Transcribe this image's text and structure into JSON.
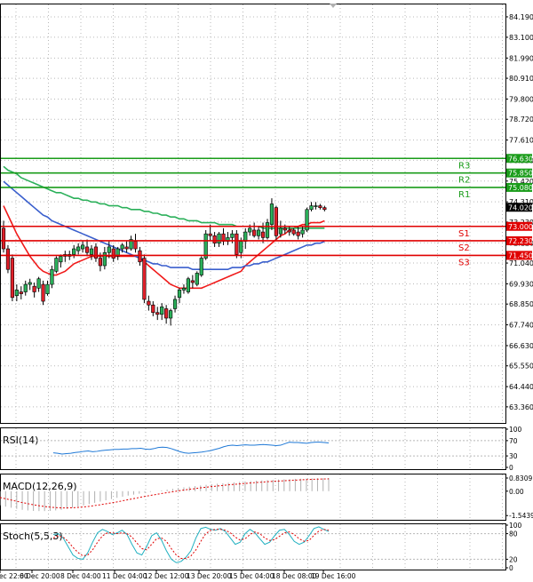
{
  "chart_data": [
    {
      "type": "candlestick",
      "panel": "price",
      "ylim": [
        62.5,
        84.9
      ],
      "y_ticks": [
        "84.190",
        "83.100",
        "81.990",
        "80.910",
        "79.800",
        "78.720",
        "77.610",
        "76.530",
        "75.420",
        "74.310",
        "73.230",
        "72.120",
        "71.040",
        "69.930",
        "68.850",
        "67.740",
        "66.630",
        "65.550",
        "64.440",
        "63.360"
      ],
      "x_tick_labels": [
        "5 Dec 22:00",
        "6 Dec 20:00",
        "8 Dec 04:00",
        "11 Dec 04:00",
        "12 Dec 12:00",
        "13 Dec 20:00",
        "15 Dec 04:00",
        "18 Dec 08:00",
        "19 Dec 16:00"
      ],
      "grid": true,
      "candles": [
        {
          "o": 72.9,
          "h": 73.3,
          "l": 71.6,
          "c": 71.8
        },
        {
          "o": 71.8,
          "h": 72.0,
          "l": 70.5,
          "c": 70.7
        },
        {
          "o": 71.3,
          "h": 71.5,
          "l": 69.0,
          "c": 69.2
        },
        {
          "o": 69.3,
          "h": 69.9,
          "l": 69.0,
          "c": 69.6
        },
        {
          "o": 69.5,
          "h": 69.8,
          "l": 69.1,
          "c": 69.4
        },
        {
          "o": 69.5,
          "h": 70.1,
          "l": 69.3,
          "c": 69.9
        },
        {
          "o": 69.9,
          "h": 70.2,
          "l": 69.6,
          "c": 70.0
        },
        {
          "o": 69.8,
          "h": 70.0,
          "l": 69.2,
          "c": 69.5
        },
        {
          "o": 69.7,
          "h": 70.3,
          "l": 69.5,
          "c": 70.2
        },
        {
          "o": 69.9,
          "h": 70.1,
          "l": 68.8,
          "c": 69.0
        },
        {
          "o": 69.4,
          "h": 70.1,
          "l": 69.3,
          "c": 69.9
        },
        {
          "o": 69.9,
          "h": 70.9,
          "l": 69.7,
          "c": 70.7
        },
        {
          "o": 70.6,
          "h": 71.4,
          "l": 70.5,
          "c": 71.3
        },
        {
          "o": 71.1,
          "h": 71.5,
          "l": 70.8,
          "c": 71.4
        },
        {
          "o": 71.4,
          "h": 71.7,
          "l": 71.1,
          "c": 71.5
        },
        {
          "o": 71.4,
          "h": 71.7,
          "l": 71.2,
          "c": 71.5
        },
        {
          "o": 71.5,
          "h": 72.0,
          "l": 71.3,
          "c": 71.8
        },
        {
          "o": 71.7,
          "h": 72.1,
          "l": 71.5,
          "c": 71.9
        },
        {
          "o": 71.8,
          "h": 72.2,
          "l": 71.6,
          "c": 72.0
        },
        {
          "o": 71.9,
          "h": 72.3,
          "l": 71.4,
          "c": 71.6
        },
        {
          "o": 71.5,
          "h": 72.0,
          "l": 71.2,
          "c": 71.8
        },
        {
          "o": 71.9,
          "h": 72.1,
          "l": 71.1,
          "c": 71.3
        },
        {
          "o": 71.3,
          "h": 71.6,
          "l": 70.6,
          "c": 70.9
        },
        {
          "o": 70.9,
          "h": 71.9,
          "l": 70.7,
          "c": 71.6
        },
        {
          "o": 71.6,
          "h": 72.2,
          "l": 71.3,
          "c": 71.9
        },
        {
          "o": 71.8,
          "h": 72.0,
          "l": 71.1,
          "c": 71.3
        },
        {
          "o": 71.4,
          "h": 71.9,
          "l": 71.2,
          "c": 71.8
        },
        {
          "o": 71.8,
          "h": 72.1,
          "l": 71.6,
          "c": 72.0
        },
        {
          "o": 71.9,
          "h": 72.2,
          "l": 71.6,
          "c": 71.8
        },
        {
          "o": 71.8,
          "h": 72.5,
          "l": 71.7,
          "c": 72.3
        },
        {
          "o": 72.2,
          "h": 72.6,
          "l": 71.6,
          "c": 71.8
        },
        {
          "o": 71.7,
          "h": 71.9,
          "l": 70.9,
          "c": 71.1
        },
        {
          "o": 71.3,
          "h": 71.5,
          "l": 68.9,
          "c": 69.1
        },
        {
          "o": 69.0,
          "h": 69.3,
          "l": 68.5,
          "c": 68.8
        },
        {
          "o": 68.8,
          "h": 69.0,
          "l": 68.2,
          "c": 68.4
        },
        {
          "o": 68.4,
          "h": 68.7,
          "l": 68.0,
          "c": 68.3
        },
        {
          "o": 68.3,
          "h": 68.9,
          "l": 68.0,
          "c": 68.7
        },
        {
          "o": 68.6,
          "h": 68.8,
          "l": 67.8,
          "c": 68.1
        },
        {
          "o": 68.1,
          "h": 68.6,
          "l": 67.7,
          "c": 68.5
        },
        {
          "o": 68.6,
          "h": 69.3,
          "l": 68.4,
          "c": 69.1
        },
        {
          "o": 69.2,
          "h": 69.7,
          "l": 68.9,
          "c": 69.6
        },
        {
          "o": 69.6,
          "h": 69.9,
          "l": 69.4,
          "c": 69.7
        },
        {
          "o": 69.5,
          "h": 70.3,
          "l": 69.4,
          "c": 70.2
        },
        {
          "o": 70.1,
          "h": 70.4,
          "l": 69.7,
          "c": 70.0
        },
        {
          "o": 69.9,
          "h": 70.6,
          "l": 69.8,
          "c": 70.5
        },
        {
          "o": 70.4,
          "h": 71.4,
          "l": 70.3,
          "c": 71.3
        },
        {
          "o": 71.3,
          "h": 72.8,
          "l": 71.2,
          "c": 72.6
        },
        {
          "o": 72.6,
          "h": 73.1,
          "l": 72.2,
          "c": 72.5
        },
        {
          "o": 72.5,
          "h": 72.7,
          "l": 71.9,
          "c": 72.1
        },
        {
          "o": 72.1,
          "h": 72.7,
          "l": 71.9,
          "c": 72.6
        },
        {
          "o": 72.6,
          "h": 72.9,
          "l": 72.0,
          "c": 72.2
        },
        {
          "o": 72.2,
          "h": 72.7,
          "l": 72.0,
          "c": 72.4
        },
        {
          "o": 72.4,
          "h": 72.8,
          "l": 72.1,
          "c": 72.6
        },
        {
          "o": 72.6,
          "h": 72.8,
          "l": 71.3,
          "c": 71.5
        },
        {
          "o": 71.6,
          "h": 72.4,
          "l": 71.3,
          "c": 72.2
        },
        {
          "o": 72.2,
          "h": 72.9,
          "l": 71.8,
          "c": 72.7
        },
        {
          "o": 72.7,
          "h": 73.1,
          "l": 72.5,
          "c": 72.9
        },
        {
          "o": 72.8,
          "h": 73.2,
          "l": 72.4,
          "c": 72.5
        },
        {
          "o": 72.5,
          "h": 73.0,
          "l": 72.3,
          "c": 72.8
        },
        {
          "o": 72.7,
          "h": 73.2,
          "l": 72.1,
          "c": 72.4
        },
        {
          "o": 72.4,
          "h": 73.4,
          "l": 72.3,
          "c": 73.2
        },
        {
          "o": 73.1,
          "h": 74.5,
          "l": 72.8,
          "c": 74.2
        },
        {
          "o": 74.0,
          "h": 74.1,
          "l": 72.3,
          "c": 72.5
        },
        {
          "o": 72.6,
          "h": 73.3,
          "l": 72.4,
          "c": 72.9
        },
        {
          "o": 72.9,
          "h": 73.1,
          "l": 72.6,
          "c": 72.8
        },
        {
          "o": 72.8,
          "h": 73.0,
          "l": 72.5,
          "c": 72.7
        },
        {
          "o": 72.8,
          "h": 72.9,
          "l": 72.5,
          "c": 72.6
        },
        {
          "o": 72.7,
          "h": 73.0,
          "l": 72.3,
          "c": 72.5
        },
        {
          "o": 72.6,
          "h": 73.0,
          "l": 72.4,
          "c": 72.8
        },
        {
          "o": 72.8,
          "h": 74.0,
          "l": 72.7,
          "c": 73.9
        },
        {
          "o": 73.9,
          "h": 74.3,
          "l": 73.8,
          "c": 74.1
        },
        {
          "o": 74.1,
          "h": 74.3,
          "l": 73.9,
          "c": 74.1
        },
        {
          "o": 74.1,
          "h": 74.2,
          "l": 73.9,
          "c": 74.0
        },
        {
          "o": 74.0,
          "h": 74.1,
          "l": 73.8,
          "c": 73.9
        }
      ],
      "moving_averages": [
        {
          "color": "#f01a1a",
          "values": [
            74.1,
            73.6,
            73.1,
            72.6,
            72.2,
            71.8,
            71.4,
            71.1,
            70.8,
            70.6,
            70.5,
            70.4,
            70.4,
            70.5,
            70.6,
            70.8,
            71.0,
            71.1,
            71.2,
            71.3,
            71.4,
            71.4,
            71.4,
            71.4,
            71.4,
            71.4,
            71.4,
            71.4,
            71.4,
            71.4,
            71.4,
            71.3,
            71.1,
            70.9,
            70.7,
            70.5,
            70.3,
            70.1,
            69.9,
            69.8,
            69.7,
            69.7,
            69.7,
            69.7,
            69.7,
            69.7,
            69.8,
            69.9,
            70.0,
            70.1,
            70.2,
            70.3,
            70.4,
            70.5,
            70.6,
            70.9,
            71.1,
            71.3,
            71.5,
            71.7,
            71.9,
            72.1,
            72.3,
            72.5,
            72.6,
            72.8,
            72.9,
            73.0,
            73.1,
            73.1,
            73.2,
            73.2,
            73.2,
            73.3
          ]
        },
        {
          "color": "#3a5fcd",
          "values": [
            75.4,
            75.2,
            75.0,
            74.8,
            74.6,
            74.4,
            74.2,
            74.0,
            73.8,
            73.6,
            73.5,
            73.3,
            73.2,
            73.1,
            73.0,
            72.9,
            72.8,
            72.7,
            72.6,
            72.5,
            72.4,
            72.3,
            72.2,
            72.1,
            72.0,
            71.9,
            71.8,
            71.7,
            71.6,
            71.5,
            71.4,
            71.3,
            71.2,
            71.1,
            71.0,
            71.0,
            70.9,
            70.9,
            70.8,
            70.8,
            70.8,
            70.8,
            70.8,
            70.7,
            70.7,
            70.7,
            70.7,
            70.7,
            70.7,
            70.7,
            70.7,
            70.7,
            70.8,
            70.8,
            70.8,
            70.9,
            70.9,
            71.0,
            71.0,
            71.1,
            71.1,
            71.2,
            71.3,
            71.4,
            71.5,
            71.6,
            71.7,
            71.8,
            71.9,
            72.0,
            72.0,
            72.1,
            72.1,
            72.2
          ]
        },
        {
          "color": "#2bb05a",
          "values": [
            76.2,
            76.0,
            75.9,
            75.8,
            75.6,
            75.5,
            75.4,
            75.3,
            75.2,
            75.1,
            75.0,
            74.9,
            74.8,
            74.8,
            74.7,
            74.6,
            74.5,
            74.5,
            74.4,
            74.4,
            74.3,
            74.3,
            74.2,
            74.2,
            74.1,
            74.1,
            74.1,
            74.0,
            74.0,
            73.9,
            73.9,
            73.9,
            73.8,
            73.8,
            73.7,
            73.7,
            73.6,
            73.6,
            73.5,
            73.5,
            73.4,
            73.4,
            73.3,
            73.3,
            73.3,
            73.2,
            73.2,
            73.2,
            73.2,
            73.1,
            73.1,
            73.1,
            73.1,
            73.0,
            73.0,
            73.0,
            73.0,
            73.0,
            73.0,
            72.9,
            72.9,
            72.9,
            72.9,
            72.9,
            72.9,
            72.9,
            72.9,
            72.9,
            72.9,
            72.9,
            72.9,
            72.9,
            72.9,
            72.9
          ]
        }
      ],
      "pivot_levels": [
        {
          "name": "R3",
          "value": 76.63,
          "label": "76.630",
          "color": "#1a9c1a"
        },
        {
          "name": "R2",
          "value": 75.85,
          "label": "75.850",
          "color": "#1a9c1a"
        },
        {
          "name": "R1",
          "value": 75.08,
          "label": "75.080",
          "color": "#1a9c1a"
        },
        {
          "name": "S1",
          "value": 73.0,
          "label": "73.000",
          "color": "#e00000"
        },
        {
          "name": "S2",
          "value": 72.23,
          "label": "72.230",
          "color": "#e00000"
        },
        {
          "name": "S3",
          "value": 71.45,
          "label": "71.450",
          "color": "#e00000"
        }
      ],
      "current_price": {
        "value": 74.02,
        "label": "74.020"
      }
    },
    {
      "type": "line",
      "panel": "rsi",
      "title": "RSI(14)",
      "ylim": [
        0,
        100
      ],
      "y_ticks": [
        "100",
        "70",
        "30",
        "0"
      ],
      "values": [
        38,
        37,
        35,
        36,
        37,
        39,
        40,
        42,
        43,
        41,
        42,
        44,
        45,
        46,
        47,
        47,
        48,
        48,
        49,
        49,
        50,
        48,
        47,
        49,
        52,
        53,
        52,
        49,
        45,
        41,
        38,
        37,
        38,
        39,
        40,
        42,
        44,
        47,
        50,
        54,
        57,
        58,
        57,
        58,
        59,
        58,
        58,
        59,
        60,
        59,
        58,
        57,
        58,
        62,
        66,
        65,
        65,
        64,
        63,
        65,
        66,
        66,
        65,
        64
      ]
    },
    {
      "type": "bar",
      "panel": "macd",
      "title": "MACD(12,26,9)",
      "ylim": [
        -1.7,
        1.0
      ],
      "y_ticks": [
        "0.8309",
        "0.00",
        "-1.5439"
      ],
      "histogram": [
        -0.9,
        -0.98,
        -1.05,
        -1.12,
        -1.18,
        -1.22,
        -1.25,
        -1.26,
        -1.26,
        -1.25,
        -1.22,
        -1.18,
        -1.12,
        -1.05,
        -0.98,
        -0.9,
        -0.82,
        -0.74,
        -0.66,
        -0.58,
        -0.5,
        -0.42,
        -0.35,
        -0.28,
        -0.22,
        -0.16,
        -0.1,
        -0.05,
        0.0,
        0.05,
        0.1,
        0.15,
        0.2,
        0.24,
        0.28,
        0.32,
        0.36,
        0.4,
        0.44,
        0.47,
        0.5,
        0.53,
        0.56,
        0.59,
        0.62,
        0.64,
        0.66,
        0.68,
        0.7,
        0.72,
        0.74,
        0.75,
        0.76,
        0.78,
        0.79,
        0.8,
        0.81,
        0.82,
        0.82,
        0.83
      ],
      "signal": [
        -0.4,
        -0.48,
        -0.56,
        -0.64,
        -0.72,
        -0.79,
        -0.86,
        -0.92,
        -0.97,
        -1.01,
        -1.04,
        -1.06,
        -1.06,
        -1.05,
        -1.03,
        -1.0,
        -0.96,
        -0.91,
        -0.86,
        -0.8,
        -0.74,
        -0.68,
        -0.61,
        -0.54,
        -0.47,
        -0.4,
        -0.33,
        -0.27,
        -0.21,
        -0.15,
        -0.09,
        -0.04,
        0.02,
        0.07,
        0.12,
        0.16,
        0.21,
        0.25,
        0.29,
        0.33,
        0.36,
        0.4,
        0.43,
        0.46,
        0.49,
        0.52,
        0.55,
        0.57,
        0.6,
        0.62,
        0.64,
        0.66,
        0.68,
        0.7,
        0.72,
        0.73,
        0.75,
        0.76,
        0.77,
        0.78
      ]
    },
    {
      "type": "line",
      "panel": "stoch",
      "title": "Stoch(5,5,3)",
      "ylim": [
        0,
        100
      ],
      "y_ticks": [
        "100",
        "80",
        "20",
        "0"
      ],
      "main": [
        78,
        80,
        70,
        50,
        30,
        22,
        20,
        35,
        60,
        82,
        90,
        85,
        78,
        82,
        88,
        78,
        55,
        35,
        30,
        50,
        75,
        82,
        65,
        40,
        20,
        12,
        15,
        25,
        40,
        70,
        92,
        95,
        90,
        88,
        92,
        85,
        70,
        55,
        60,
        80,
        90,
        82,
        68,
        55,
        60,
        75,
        88,
        90,
        78,
        62,
        55,
        60,
        75,
        92,
        96,
        90,
        85
      ],
      "signal": [
        70,
        75,
        72,
        62,
        48,
        36,
        28,
        30,
        42,
        60,
        75,
        82,
        82,
        80,
        82,
        80,
        72,
        58,
        45,
        42,
        55,
        68,
        70,
        62,
        45,
        30,
        22,
        22,
        28,
        42,
        62,
        80,
        88,
        90,
        90,
        88,
        82,
        72,
        65,
        68,
        78,
        84,
        80,
        70,
        64,
        66,
        74,
        82,
        84,
        78,
        68,
        62,
        64,
        76,
        86,
        90,
        88
      ]
    }
  ]
}
